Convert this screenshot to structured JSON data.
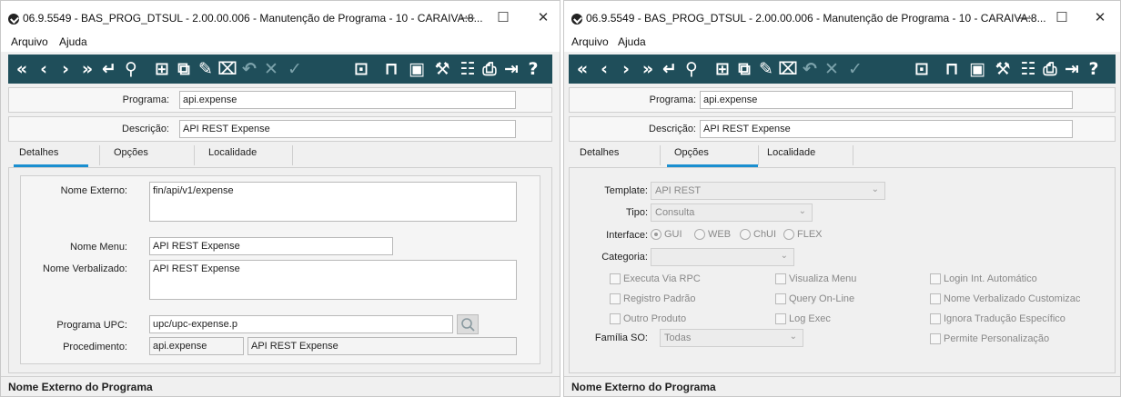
{
  "window_title": "06.9.5549 - BAS_PROG_DTSUL - 2.00.00.006 - Manutenção de Programa - 10 - CARAIVA:8...",
  "window_controls": {
    "minimize": "—",
    "maximize": "☐",
    "close": "✕"
  },
  "menu": [
    "Arquivo",
    "Ajuda"
  ],
  "toolbar_icons": [
    "first-icon",
    "prev-icon",
    "next-icon",
    "last-icon",
    "goto-icon",
    "search-icon",
    "new-icon",
    "copy-icon",
    "edit-icon",
    "delete-icon",
    "undo-icon",
    "cancel-icon",
    "save-icon",
    "zoom-icon",
    "lock-icon",
    "report-icon",
    "tools-icon",
    "hierarchy-icon",
    "print-icon",
    "exit-icon",
    "help-icon"
  ],
  "colors": {
    "toolbar": "#1f4e5a",
    "tab_underline": "#1a8fd0"
  },
  "header": {
    "programa_label": "Programa:",
    "programa_value": "api.expense",
    "descricao_label": "Descrição:",
    "descricao_value": "API REST Expense"
  },
  "tabs": [
    "Detalhes",
    "Opções",
    "Localidade"
  ],
  "detalhes": {
    "nome_externo_label": "Nome Externo:",
    "nome_externo_value": "fin/api/v1/expense",
    "nome_menu_label": "Nome Menu:",
    "nome_menu_value": "API REST Expense",
    "nome_verbalizado_label": "Nome Verbalizado:",
    "nome_verbalizado_value": "API REST Expense",
    "programa_upc_label": "Programa UPC:",
    "programa_upc_value": "upc/upc-expense.p",
    "procedimento_label": "Procedimento:",
    "procedimento_value": "api.expense",
    "procedimento_desc": "API REST Expense"
  },
  "opcoes": {
    "template_label": "Template:",
    "template_value": "API REST",
    "tipo_label": "Tipo:",
    "tipo_value": "Consulta",
    "interface_label": "Interface:",
    "interface_options": [
      "GUI",
      "WEB",
      "ChUI",
      "FLEX"
    ],
    "interface_selected": "GUI",
    "categoria_label": "Categoria:",
    "categoria_value": "",
    "checkboxes_col1": [
      "Executa Via RPC",
      "Registro Padrão",
      "Outro Produto"
    ],
    "checkboxes_col2": [
      "Visualiza Menu",
      "Query On-Line",
      "Log Exec"
    ],
    "checkboxes_col3": [
      "Login Int. Automático",
      "Nome Verbalizado Customizac",
      "Ignora Tradução Específico",
      "Permite Personalização"
    ],
    "familia_label": "Família SO:",
    "familia_value": "Todas"
  },
  "status_text": "Nome Externo do Programa"
}
